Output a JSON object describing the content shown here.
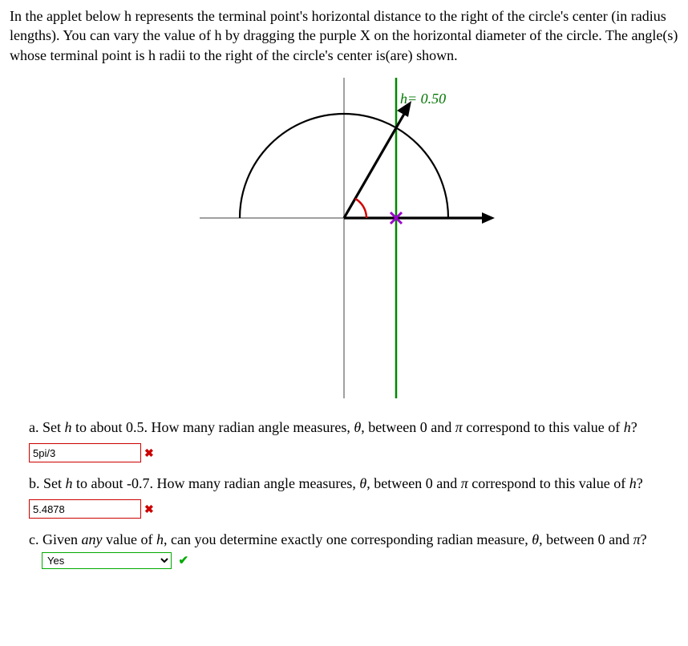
{
  "intro": "In the applet below h represents the terminal point's horizontal distance to the right of the circle's center (in radius lengths). You can vary the value of h by dragging the purple X on the horizontal diameter of the circle. The angle(s) whose terminal point is h radii to the right of the circle's center is(are) shown.",
  "h_label_var": "h",
  "h_label_eq": "= 0.50",
  "chart_data": {
    "type": "line",
    "title": "",
    "h_value": 0.5,
    "radius": 1,
    "angle_rad": 1.0472,
    "terminal_point": {
      "x": 0.5,
      "y": 0.866
    },
    "x_axis_range": [
      -1.4,
      1.4
    ],
    "y_axis_range": [
      -1.15,
      1.15
    ],
    "vertical_line_at": 0.5,
    "series": [
      {
        "name": "semicircle",
        "type": "arc",
        "start": 0,
        "end": 3.14159
      },
      {
        "name": "initial-ray",
        "from": [
          0,
          0
        ],
        "to": [
          1.35,
          0
        ]
      },
      {
        "name": "terminal-ray",
        "from": [
          0,
          0
        ],
        "to": [
          0.55,
          0.953
        ]
      },
      {
        "name": "angle-arc",
        "radius": 0.22,
        "from_angle": 0,
        "to_angle": 1.0472,
        "color": "red"
      }
    ],
    "marker": {
      "x": 0.5,
      "y": 0.0,
      "symbol": "x",
      "color": "purple"
    }
  },
  "qa": {
    "a": {
      "prompt_pre": "a. Set ",
      "prompt_var": "h",
      "prompt_mid": " to about 0.5. How many radian angle measures, ",
      "prompt_theta": "θ",
      "prompt_post1": ", between 0 and ",
      "prompt_pi": "π",
      "prompt_post2": " correspond to this value of ",
      "prompt_var2": "h",
      "prompt_end": "?",
      "answer": "5pi/3",
      "status": "wrong"
    },
    "b": {
      "prompt_pre": "b. Set ",
      "prompt_var": "h",
      "prompt_mid": " to about -0.7. How many radian angle measures, ",
      "prompt_theta": "θ",
      "prompt_post1": ", between 0 and ",
      "prompt_pi": "π",
      "prompt_post2": " correspond to this value of ",
      "prompt_var2": "h",
      "prompt_end": "?",
      "answer": "5.4878",
      "status": "wrong"
    },
    "c": {
      "prompt_pre": "c. Given ",
      "prompt_any": "any",
      "prompt_mid1": " value of ",
      "prompt_var": "h",
      "prompt_mid2": ", can you determine exactly one corresponding radian measure, ",
      "prompt_theta": "θ",
      "prompt_post1": ", between 0 and ",
      "prompt_pi": "π",
      "prompt_end": "?",
      "selected": "Yes",
      "status": "correct"
    }
  }
}
